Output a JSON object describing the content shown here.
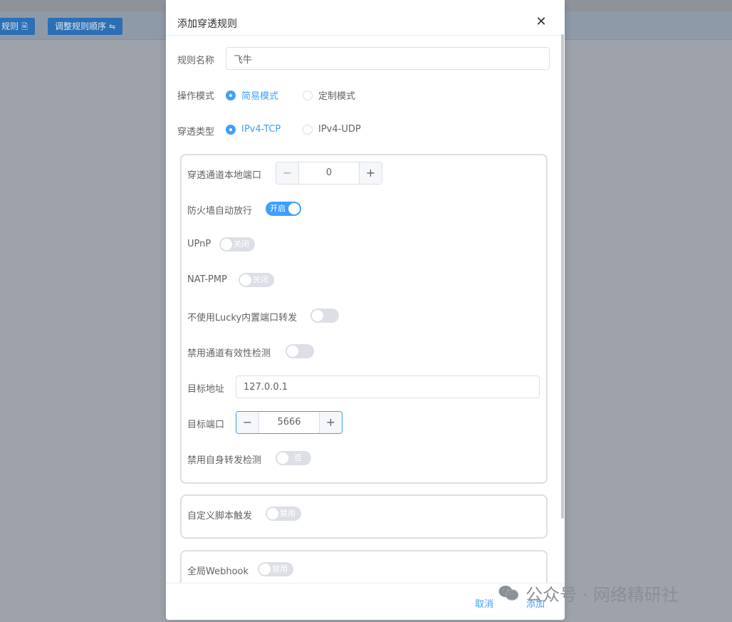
{
  "background": {
    "toolbar_buttons": [
      {
        "label": "规则",
        "icon": "document-icon"
      },
      {
        "label": "调整规则顺序",
        "icon": "swap-icon"
      }
    ]
  },
  "dialog": {
    "title": "添加穿透规则",
    "close_glyph": "✕",
    "rule_name": {
      "label": "规则名称",
      "value": "飞牛"
    },
    "mode": {
      "label": "操作模式",
      "options": [
        "简易模式",
        "定制模式"
      ],
      "selected": "简易模式"
    },
    "type": {
      "label": "穿透类型",
      "options": [
        "IPv4-TCP",
        "IPv4-UDP"
      ],
      "selected": "IPv4-TCP"
    },
    "local_port": {
      "label": "穿透通道本地端口",
      "value": "0",
      "minus": "−",
      "plus": "+"
    },
    "firewall": {
      "label": "防火墙自动放行",
      "state": "开启",
      "on": true
    },
    "upnp": {
      "label": "UPnP",
      "state": "关闭",
      "on": false
    },
    "natpmp": {
      "label": "NAT-PMP",
      "state": "关闭",
      "on": false
    },
    "no_lucky": {
      "label": "不使用Lucky内置端口转发",
      "on": false
    },
    "no_check": {
      "label": "禁用通道有效性检测",
      "on": false
    },
    "target_addr": {
      "label": "目标地址",
      "value": "127.0.0.1"
    },
    "target_port": {
      "label": "目标端口",
      "value": "5666",
      "minus": "−",
      "plus": "+"
    },
    "self_check": {
      "label": "禁用自身转发检测",
      "state": "否",
      "on": false
    },
    "custom_script": {
      "label": "自定义脚本触发",
      "state": "禁用",
      "on": false
    },
    "webhook": {
      "label": "全局Webhook",
      "state": "禁用",
      "on": false
    },
    "footer": {
      "cancel": "取消",
      "confirm": "添加"
    }
  },
  "watermark": {
    "text": "公众号 · 网络精研社",
    "icon": "wechat-icon"
  },
  "colors": {
    "primary": "#409eff",
    "border": "#dcdfe6",
    "text": "#606266",
    "backdrop": "#9ea3ab"
  }
}
